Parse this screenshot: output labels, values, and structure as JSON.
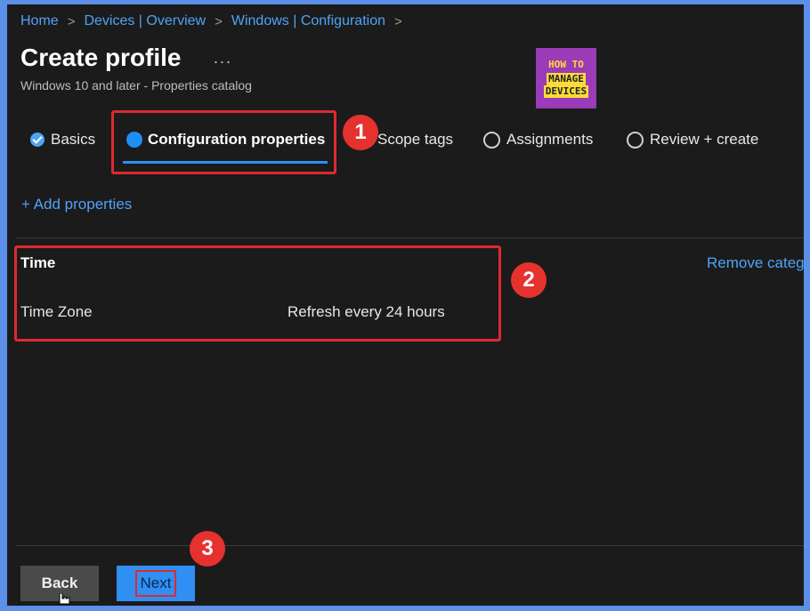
{
  "breadcrumb": [
    "Home",
    "Devices | Overview",
    "Windows | Configuration"
  ],
  "page": {
    "title": "Create profile",
    "more_label": "...",
    "subtitle": "Windows 10 and later - Properties catalog"
  },
  "logo": {
    "line1": "HOW TO",
    "line2": "MANAGE",
    "line3": "DEVICES"
  },
  "steps": [
    {
      "label": "Basics",
      "state": "completed"
    },
    {
      "label": "Configuration properties",
      "state": "active"
    },
    {
      "label": "Scope tags",
      "state": "pending"
    },
    {
      "label": "Assignments",
      "state": "pending"
    },
    {
      "label": "Review + create",
      "state": "pending"
    }
  ],
  "add_properties_label": "+ Add properties",
  "category": {
    "name": "Time",
    "remove_label": "Remove categ",
    "setting_name": "Time Zone",
    "setting_value": "Refresh every 24 hours"
  },
  "annotations": [
    "1",
    "2",
    "3"
  ],
  "footer": {
    "back_label": "Back",
    "next_label": "Next"
  },
  "colors": {
    "accent": "#2f8ff2",
    "link": "#4fa3f7",
    "highlight": "#e02930",
    "background": "#1b1b1b",
    "frame": "#5b8fe8"
  }
}
